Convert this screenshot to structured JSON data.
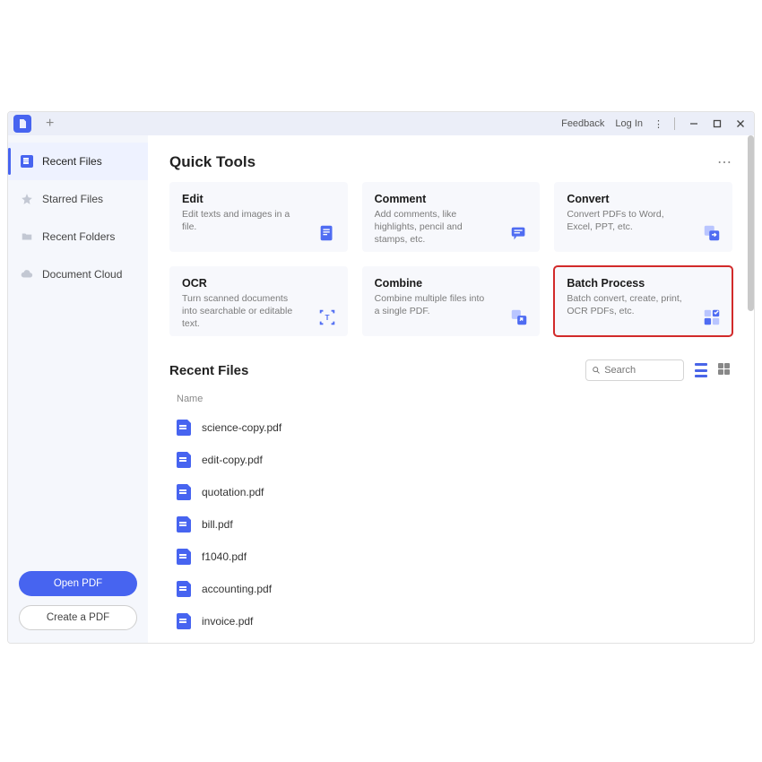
{
  "titlebar": {
    "feedback": "Feedback",
    "login": "Log In"
  },
  "sidebar": {
    "items": [
      {
        "label": "Recent Files"
      },
      {
        "label": "Starred Files"
      },
      {
        "label": "Recent Folders"
      },
      {
        "label": "Document Cloud"
      }
    ],
    "open_pdf": "Open PDF",
    "create_pdf": "Create a PDF"
  },
  "main": {
    "quick_tools_title": "Quick Tools",
    "tools": [
      {
        "title": "Edit",
        "desc": "Edit texts and images in a file."
      },
      {
        "title": "Comment",
        "desc": "Add comments, like highlights, pencil and stamps, etc."
      },
      {
        "title": "Convert",
        "desc": "Convert PDFs to Word, Excel, PPT, etc."
      },
      {
        "title": "OCR",
        "desc": "Turn scanned documents into searchable or editable text."
      },
      {
        "title": "Combine",
        "desc": "Combine multiple files into a single PDF."
      },
      {
        "title": "Batch Process",
        "desc": "Batch convert, create, print, OCR PDFs, etc."
      }
    ],
    "recent_title": "Recent Files",
    "search_placeholder": "Search",
    "col_name": "Name",
    "files": [
      "science-copy.pdf",
      "edit-copy.pdf",
      "quotation.pdf",
      "bill.pdf",
      "f1040.pdf",
      "accounting.pdf",
      "invoice.pdf"
    ]
  }
}
